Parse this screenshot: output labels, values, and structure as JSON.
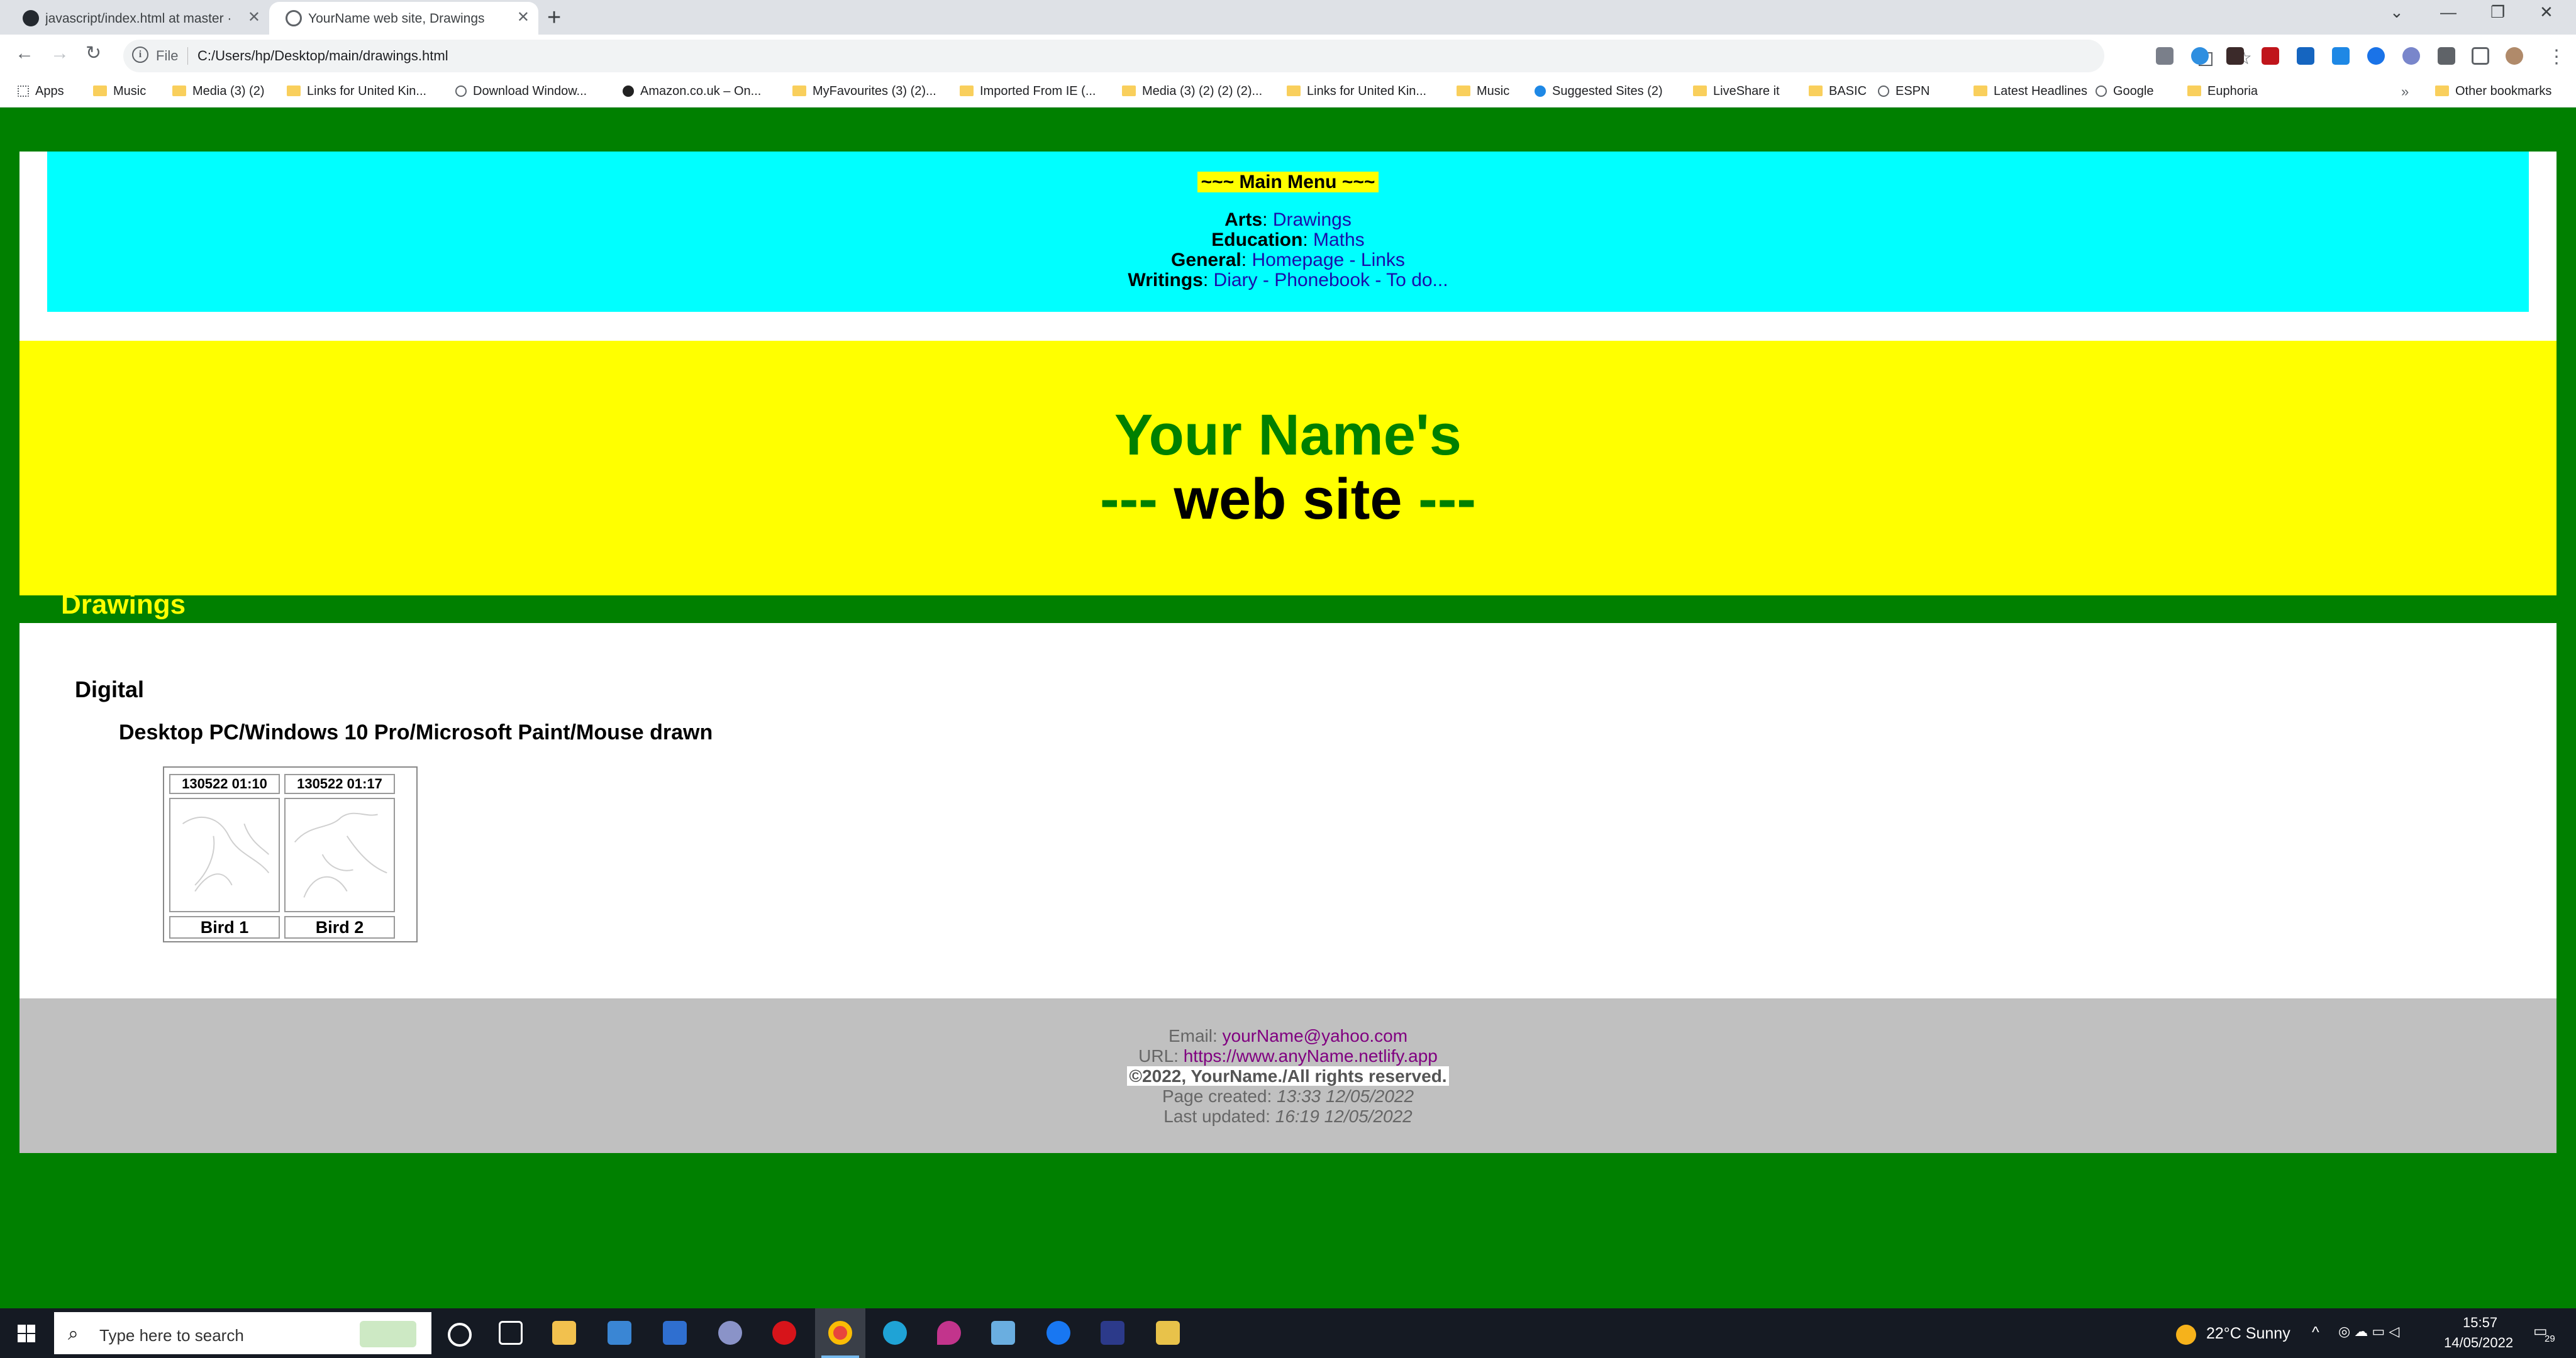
{
  "browser": {
    "tabs": [
      {
        "title": "javascript/index.html at master · j",
        "active": false
      },
      {
        "title": "YourName web site, Drawings",
        "active": true
      }
    ],
    "new_tab_symbol": "+",
    "url_scheme_label": "File",
    "url": "C:/Users/hp/Desktop/main/drawings.html",
    "bookmarks": [
      {
        "label": "Apps",
        "icon": "apps-grid-icon"
      },
      {
        "label": "Music",
        "icon": "folder-icon"
      },
      {
        "label": "Media (3) (2)",
        "icon": "folder-icon"
      },
      {
        "label": "Links for United Kin...",
        "icon": "folder-icon"
      },
      {
        "label": "Download Window...",
        "icon": "globe-icon"
      },
      {
        "label": "Amazon.co.uk – On...",
        "icon": "amazon-icon"
      },
      {
        "label": "MyFavourites (3) (2)...",
        "icon": "folder-icon"
      },
      {
        "label": "Imported From IE (...",
        "icon": "folder-icon"
      },
      {
        "label": "Media (3) (2) (2) (2)...",
        "icon": "folder-icon"
      },
      {
        "label": "Links for United Kin...",
        "icon": "folder-icon"
      },
      {
        "label": "Music",
        "icon": "folder-icon"
      },
      {
        "label": "Suggested Sites (2)",
        "icon": "bing-icon"
      },
      {
        "label": "LiveShare it",
        "icon": "folder-icon"
      },
      {
        "label": "BASIC",
        "icon": "folder-icon"
      },
      {
        "label": "ESPN",
        "icon": "globe-icon"
      },
      {
        "label": "Latest Headlines",
        "icon": "folder-icon"
      },
      {
        "label": "Google",
        "icon": "globe-icon"
      },
      {
        "label": "Euphoria",
        "icon": "folder-icon"
      }
    ],
    "bookmarks_more": "»",
    "other_bookmarks": "Other bookmarks"
  },
  "menu": {
    "title": "~~~ Main Menu ~~~",
    "rows": [
      {
        "label": "Arts",
        "links": [
          "Drawings"
        ]
      },
      {
        "label": "Education",
        "links": [
          "Maths"
        ]
      },
      {
        "label": "General",
        "links": [
          "Homepage",
          "Links"
        ]
      },
      {
        "label": "Writings",
        "links": [
          "Diary",
          "Phonebook",
          "To do..."
        ]
      }
    ],
    "separator": " - "
  },
  "banner": {
    "line1": "Your Name's",
    "line2_dash": "---",
    "line2_text": "web site"
  },
  "section": {
    "heading": "Drawings",
    "category": "Digital",
    "subheading": "Desktop PC/Windows 10 Pro/Microsoft Paint/Mouse drawn",
    "gallery": [
      {
        "date": "130522 01:10",
        "label": "Bird 1"
      },
      {
        "date": "130522 01:17",
        "label": "Bird 2"
      }
    ]
  },
  "footer": {
    "email_label": "Email:",
    "email": "yourName@yahoo.com",
    "url_label": "URL:",
    "url": "https://www.anyName.netlify.app",
    "copyright": "©2022, YourName./All rights reserved.",
    "created_label": "Page created:",
    "created": "13:33 12/05/2022",
    "updated_label": "Last updated:",
    "updated": "16:19 12/05/2022"
  },
  "taskbar": {
    "search_placeholder": "Type here to search",
    "weather": "22°C  Sunny",
    "time": "15:57",
    "date": "14/05/2022",
    "notifications": "29"
  },
  "colors": {
    "page_background": "#008000",
    "menu_background": "#00ffff",
    "banner_background": "#ffff00",
    "footer_background": "#c0c0c0",
    "link": "#1a0dab",
    "visited_link": "#800080"
  }
}
